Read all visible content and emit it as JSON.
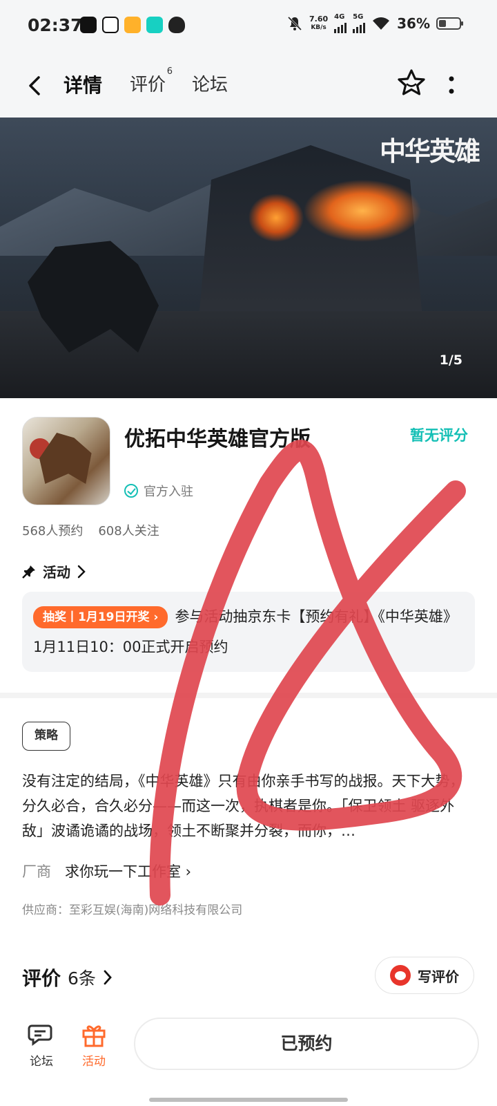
{
  "status_bar": {
    "time": "02:37",
    "net_speed_top": "7.60",
    "net_speed_unit": "KB/s",
    "sig1": "4G",
    "sig2": "5G",
    "battery": "36%",
    "battery_level": 0.36
  },
  "nav": {
    "tabs": [
      {
        "label": "详情"
      },
      {
        "label": "评价",
        "badge": "6"
      },
      {
        "label": "论坛"
      }
    ]
  },
  "banner": {
    "logo_text": "中华英雄",
    "counter": "1/5"
  },
  "app": {
    "name": "优拓中华英雄官方版",
    "rating": "暂无评分",
    "official": "官方入驻",
    "reservations": "568人预约",
    "followers": "608人关注"
  },
  "activity": {
    "heading": "活动",
    "badge": "抽奖丨1月19日开奖",
    "text": "参与活动抽京东卡【预约有礼】《中华英雄》1月11日10：00正式开启预约"
  },
  "info": {
    "tag": "策略",
    "description": "没有注定的结局，《中华英雄》只有由你亲手书写的战报。天下大势，分久必合，合久必分——而这一次，执棋者是你。「保卫领土 驱逐外敌」波谲诡谲的战场，领土不断聚并分裂，而你，…",
    "vendor_label": "厂商",
    "vendor_name": "求你玩一下工作室",
    "supplier": "供应商：至彩互娱(海南)网络科技有限公司"
  },
  "reviews": {
    "title": "评价",
    "count": "6条",
    "write_label": "写评价"
  },
  "bottom": {
    "forum_label": "论坛",
    "activity_label": "活动",
    "reserved_label": "已预约"
  },
  "colors": {
    "accent": "#17d0c2",
    "orange": "#ff6a2c",
    "mark_red": "#e0474f"
  }
}
